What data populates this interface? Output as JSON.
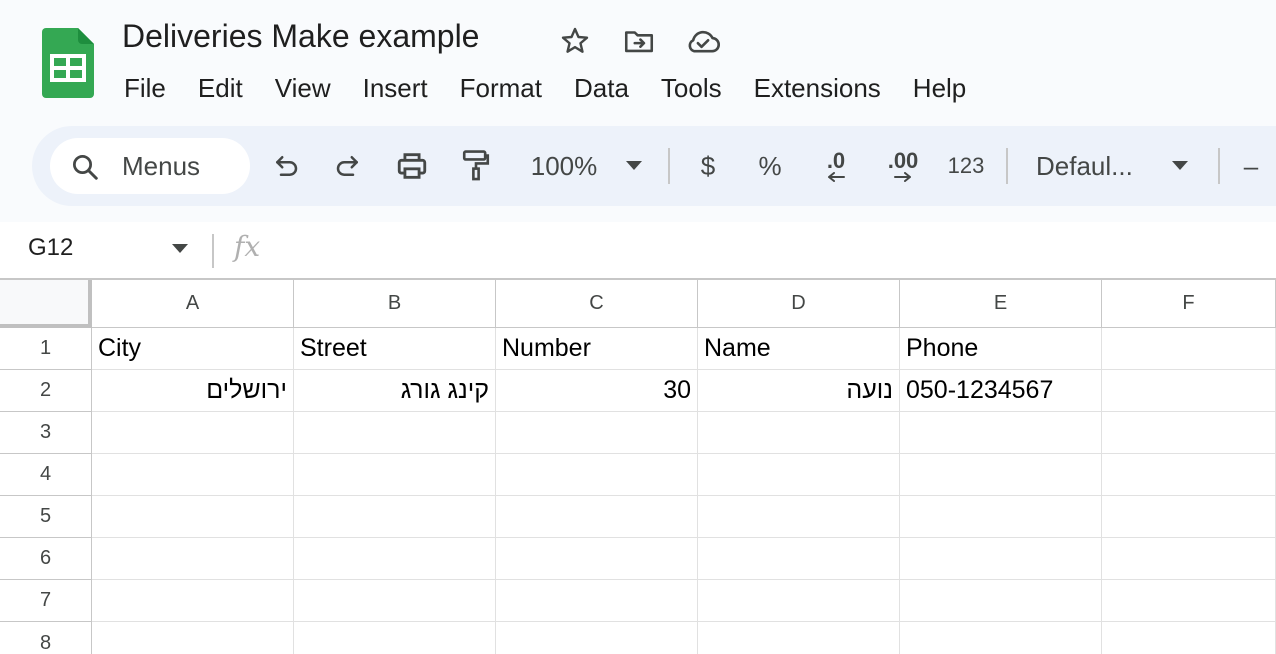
{
  "document": {
    "title": "Deliveries Make example"
  },
  "menus": [
    "File",
    "Edit",
    "View",
    "Insert",
    "Format",
    "Data",
    "Tools",
    "Extensions",
    "Help"
  ],
  "toolbar": {
    "search_placeholder": "Menus",
    "zoom": "100%",
    "currency": "$",
    "percent": "%",
    "decrease_decimal": ".0",
    "increase_decimal": ".00",
    "number_format": "123",
    "font": "Defaul...",
    "font_size_minus": "–"
  },
  "formula_bar": {
    "cell_ref": "G12",
    "fx": "fx"
  },
  "sheet": {
    "columns": [
      "A",
      "B",
      "C",
      "D",
      "E",
      "F"
    ],
    "rows": [
      "1",
      "2",
      "3",
      "4",
      "5",
      "6",
      "7",
      "8"
    ],
    "cells": {
      "A1": "City",
      "B1": "Street",
      "C1": "Number",
      "D1": "Name",
      "E1": "Phone",
      "A2": "ירושלים",
      "B2": "קינג גורג",
      "C2": "30",
      "D2": "נועה",
      "E2": "050-1234567"
    }
  },
  "colors": {
    "logo_green": "#34a853",
    "toolbar_bg": "#edf2fa",
    "icon": "#444746"
  }
}
